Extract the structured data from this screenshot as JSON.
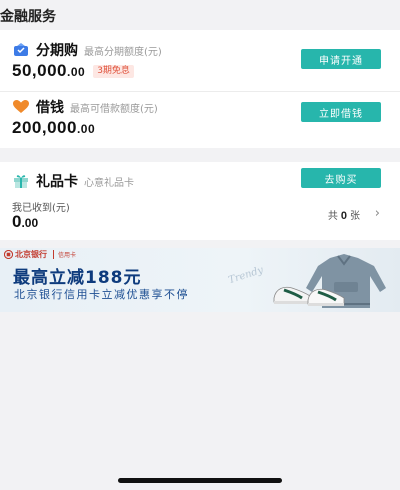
{
  "section_title": "金融服务",
  "installment": {
    "icon": "cube-icon",
    "label": "分期购",
    "sub": "最高分期额度(元)",
    "amount_int": "50,000",
    "amount_dec": ".00",
    "badge": "3期免息",
    "button": "申请开通"
  },
  "loan": {
    "icon": "heart-icon",
    "label": "借钱",
    "sub": "最高可借款额度(元)",
    "amount_int": "200,000",
    "amount_dec": ".00",
    "button": "立即借钱"
  },
  "gift_card": {
    "icon": "gift-icon",
    "label": "礼品卡",
    "sub": "心意礼品卡",
    "button": "去购买",
    "received_label": "我已收到(元)",
    "received_int": "0",
    "received_dec": ".00",
    "count_prefix": "共",
    "count": "0",
    "count_suffix": "张",
    "chevron": "›"
  },
  "banner": {
    "bank_name": "北京银行",
    "bank_tag": "信用卡",
    "headline": "最高立减188元",
    "sub": "北京银行信用卡立减优惠享不停",
    "script": "Trendy"
  },
  "colors": {
    "accent": "#27b6ac",
    "badge_text": "#e0543e",
    "banner_text": "#0e3b7d"
  }
}
